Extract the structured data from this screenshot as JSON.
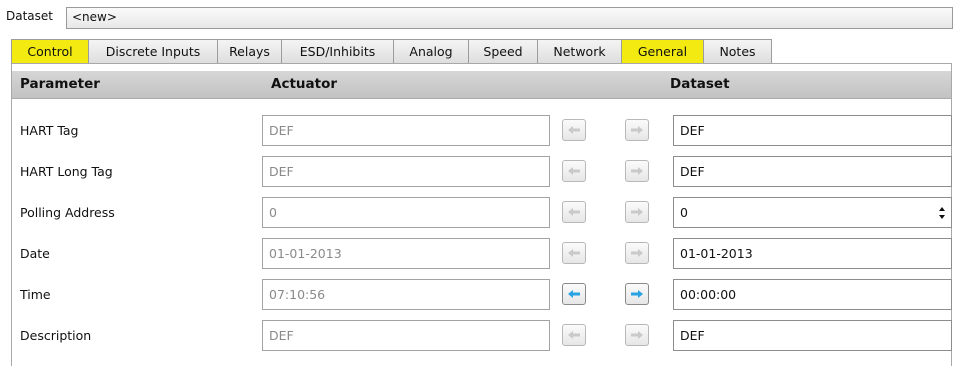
{
  "dataset": {
    "label": "Dataset",
    "value": "<new>"
  },
  "tabs": [
    {
      "label": "Control",
      "active": true
    },
    {
      "label": "Discrete Inputs",
      "active": false
    },
    {
      "label": "Relays",
      "active": false
    },
    {
      "label": "ESD/Inhibits",
      "active": false
    },
    {
      "label": "Analog",
      "active": false
    },
    {
      "label": "Speed",
      "active": false
    },
    {
      "label": "Network",
      "active": false
    },
    {
      "label": "General",
      "active": true
    },
    {
      "label": "Notes",
      "active": false
    }
  ],
  "table": {
    "headers": {
      "parameter": "Parameter",
      "actuator": "Actuator",
      "dataset": "Dataset"
    },
    "rows": [
      {
        "parameter": "HART Tag",
        "actuator": "DEF",
        "dataset": "DEF",
        "arrows_enabled": false,
        "has_spinner": false
      },
      {
        "parameter": "HART Long Tag",
        "actuator": "DEF",
        "dataset": "DEF",
        "arrows_enabled": false,
        "has_spinner": false
      },
      {
        "parameter": "Polling Address",
        "actuator": "0",
        "dataset": "0",
        "arrows_enabled": false,
        "has_spinner": true
      },
      {
        "parameter": "Date",
        "actuator": "01-01-2013",
        "dataset": "01-01-2013",
        "arrows_enabled": false,
        "has_spinner": false
      },
      {
        "parameter": "Time",
        "actuator": "07:10:56",
        "dataset": "00:00:00",
        "arrows_enabled": true,
        "has_spinner": false
      },
      {
        "parameter": "Description",
        "actuator": "DEF",
        "dataset": "DEF",
        "arrows_enabled": false,
        "has_spinner": false
      }
    ]
  },
  "colors": {
    "active_tab": "#f2ea10",
    "arrow_enabled": "#29a3e3",
    "arrow_disabled": "#c9c9c9",
    "header_bg": "#c8c8c8"
  }
}
